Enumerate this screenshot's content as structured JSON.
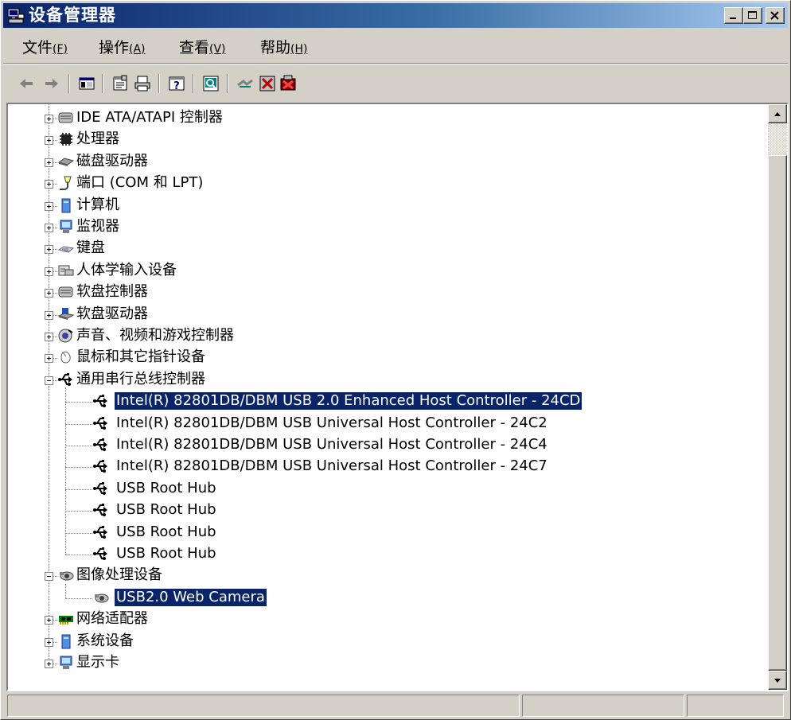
{
  "window": {
    "title": "设备管理器"
  },
  "menu": [
    {
      "label": "文件",
      "accel": "(F)",
      "key": "F"
    },
    {
      "label": "操作",
      "accel": "(A)",
      "key": "A"
    },
    {
      "label": "查看",
      "accel": "(V)",
      "key": "V"
    },
    {
      "label": "帮助",
      "accel": "(H)",
      "key": "H"
    }
  ],
  "toolbar": [
    "back-arrow-icon",
    "forward-arrow-icon",
    "show-hide-console-tree-icon",
    "properties-icon",
    "print-icon",
    "help-icon",
    "scan-hardware-icon",
    "update-driver-icon",
    "disable-device-icon",
    "uninstall-device-icon"
  ],
  "tree": [
    {
      "label": "IDE ATA/ATAPI 控制器",
      "icon": "ide-controller-icon",
      "level": 1,
      "expand": "plus"
    },
    {
      "label": "处理器",
      "icon": "processor-icon",
      "level": 1,
      "expand": "plus"
    },
    {
      "label": "磁盘驱动器",
      "icon": "disk-drive-icon",
      "level": 1,
      "expand": "plus"
    },
    {
      "label": "端口 (COM 和 LPT)",
      "icon": "port-icon",
      "level": 1,
      "expand": "plus"
    },
    {
      "label": "计算机",
      "icon": "computer-icon",
      "level": 1,
      "expand": "plus"
    },
    {
      "label": "监视器",
      "icon": "monitor-icon",
      "level": 1,
      "expand": "plus"
    },
    {
      "label": "键盘",
      "icon": "keyboard-icon",
      "level": 1,
      "expand": "plus"
    },
    {
      "label": "人体学输入设备",
      "icon": "hid-icon",
      "level": 1,
      "expand": "plus"
    },
    {
      "label": "软盘控制器",
      "icon": "floppy-controller-icon",
      "level": 1,
      "expand": "plus"
    },
    {
      "label": "软盘驱动器",
      "icon": "floppy-drive-icon",
      "level": 1,
      "expand": "plus"
    },
    {
      "label": "声音、视频和游戏控制器",
      "icon": "sound-icon",
      "level": 1,
      "expand": "plus"
    },
    {
      "label": "鼠标和其它指针设备",
      "icon": "mouse-icon",
      "level": 1,
      "expand": "plus"
    },
    {
      "label": "通用串行总线控制器",
      "icon": "usb-icon",
      "level": 1,
      "expand": "minus"
    },
    {
      "label": "Intel(R) 82801DB/DBM USB 2.0 Enhanced Host Controller - 24CD",
      "icon": "usb-icon",
      "level": 2,
      "selected": true
    },
    {
      "label": "Intel(R) 82801DB/DBM USB Universal Host Controller - 24C2",
      "icon": "usb-icon",
      "level": 2
    },
    {
      "label": "Intel(R) 82801DB/DBM USB Universal Host Controller - 24C4",
      "icon": "usb-icon",
      "level": 2
    },
    {
      "label": "Intel(R) 82801DB/DBM USB Universal Host Controller - 24C7",
      "icon": "usb-icon",
      "level": 2
    },
    {
      "label": "USB Root Hub",
      "icon": "usb-icon",
      "level": 2
    },
    {
      "label": "USB Root Hub",
      "icon": "usb-icon",
      "level": 2
    },
    {
      "label": "USB Root Hub",
      "icon": "usb-icon",
      "level": 2
    },
    {
      "label": "USB Root Hub",
      "icon": "usb-icon",
      "level": 2
    },
    {
      "label": "图像处理设备",
      "icon": "imaging-icon",
      "level": 1,
      "expand": "minus"
    },
    {
      "label": "USB2.0 Web Camera",
      "icon": "imaging-icon",
      "level": 2,
      "selected": true
    },
    {
      "label": "网络适配器",
      "icon": "network-adapter-icon",
      "level": 1,
      "expand": "plus"
    },
    {
      "label": "系统设备",
      "icon": "system-device-icon",
      "level": 1,
      "expand": "plus"
    },
    {
      "label": "显示卡",
      "icon": "display-adapter-icon",
      "level": 1,
      "expand": "plus"
    }
  ],
  "status": [
    "",
    "",
    ""
  ],
  "colors": {
    "title_start": "#0a246a",
    "title_end": "#a6caf0",
    "selection": "#0a246a",
    "face": "#d4d0c8"
  }
}
